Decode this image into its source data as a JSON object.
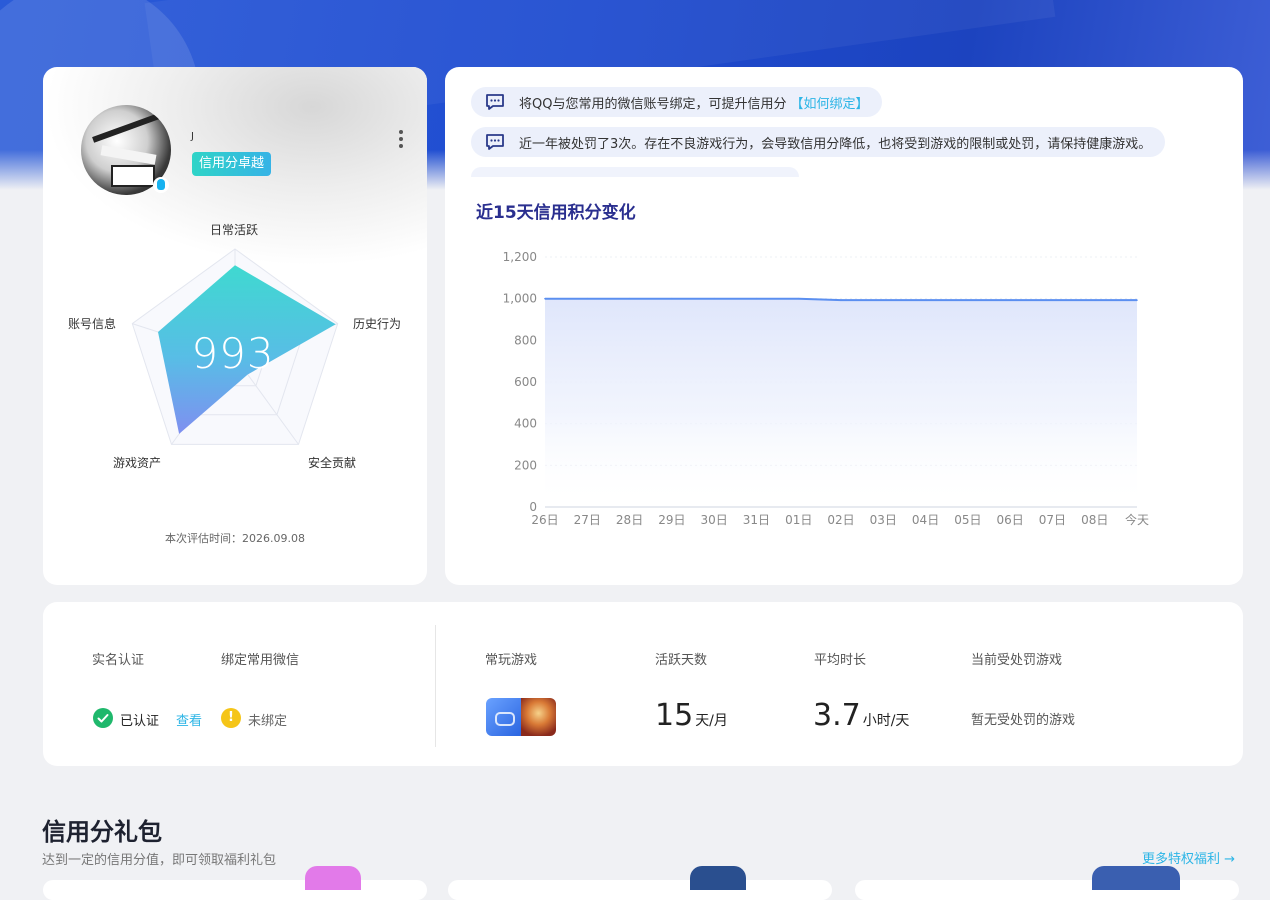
{
  "profile": {
    "username": "J",
    "credit_badge": "信用分卓越",
    "score": "993",
    "radar": {
      "labels": [
        "日常活跃",
        "历史行为",
        "安全贡献",
        "游戏资产",
        "账号信息"
      ],
      "values": [
        0.85,
        0.98,
        0.2,
        0.88,
        0.75
      ]
    },
    "eval_time": "本次评估时间：2026.09.08"
  },
  "notices": [
    {
      "text": "将QQ与您常用的微信账号绑定，可提升信用分",
      "link": "【如何绑定】",
      "icon": "message-icon"
    },
    {
      "text": "近一年被处罚了3次。存在不良游戏行为，会导致信用分降低，也将受到游戏的限制或处罚，请保持健康游戏。",
      "icon": "message-icon"
    }
  ],
  "chart_title": "近15天信用积分变化",
  "chart_data": {
    "type": "area",
    "title": "近15天信用积分变化",
    "categories": [
      "26日",
      "27日",
      "28日",
      "29日",
      "30日",
      "31日",
      "01日",
      "02日",
      "03日",
      "04日",
      "05日",
      "06日",
      "07日",
      "08日",
      "今天"
    ],
    "values": [
      1000,
      1000,
      1000,
      1000,
      1000,
      1000,
      1000,
      993,
      993,
      993,
      993,
      993,
      993,
      993,
      993
    ],
    "ylim": [
      0,
      1200
    ],
    "yticks": [
      "0",
      "200",
      "400",
      "600",
      "800",
      "1,000",
      "1,200"
    ],
    "grid": true,
    "color": "#5b8ff0",
    "fill": "#dfe6fb"
  },
  "stats": {
    "realname_label": "实名认证",
    "wechat_label": "绑定常用微信",
    "realname_status": "已认证",
    "realname_link": "查看",
    "wechat_status": "未绑定",
    "games_label": "常玩游戏",
    "active_days_label": "活跃天数",
    "active_days_value": "15",
    "active_days_unit": "天/月",
    "avg_time_label": "平均时长",
    "avg_time_value": "3.7",
    "avg_time_unit": "小时/天",
    "punished_label": "当前受处罚游戏",
    "punished_value": "暂无受处罚的游戏"
  },
  "gift": {
    "title": "信用分礼包",
    "subtitle": "达到一定的信用分值，即可领取福利礼包",
    "more_link": "更多特权福利",
    "more_arrow": "→"
  },
  "colors": {
    "brand_blue": "#1f4cd0",
    "accent_cyan": "#2cb5e6",
    "success": "#1fb86c",
    "warning": "#f5c518"
  }
}
